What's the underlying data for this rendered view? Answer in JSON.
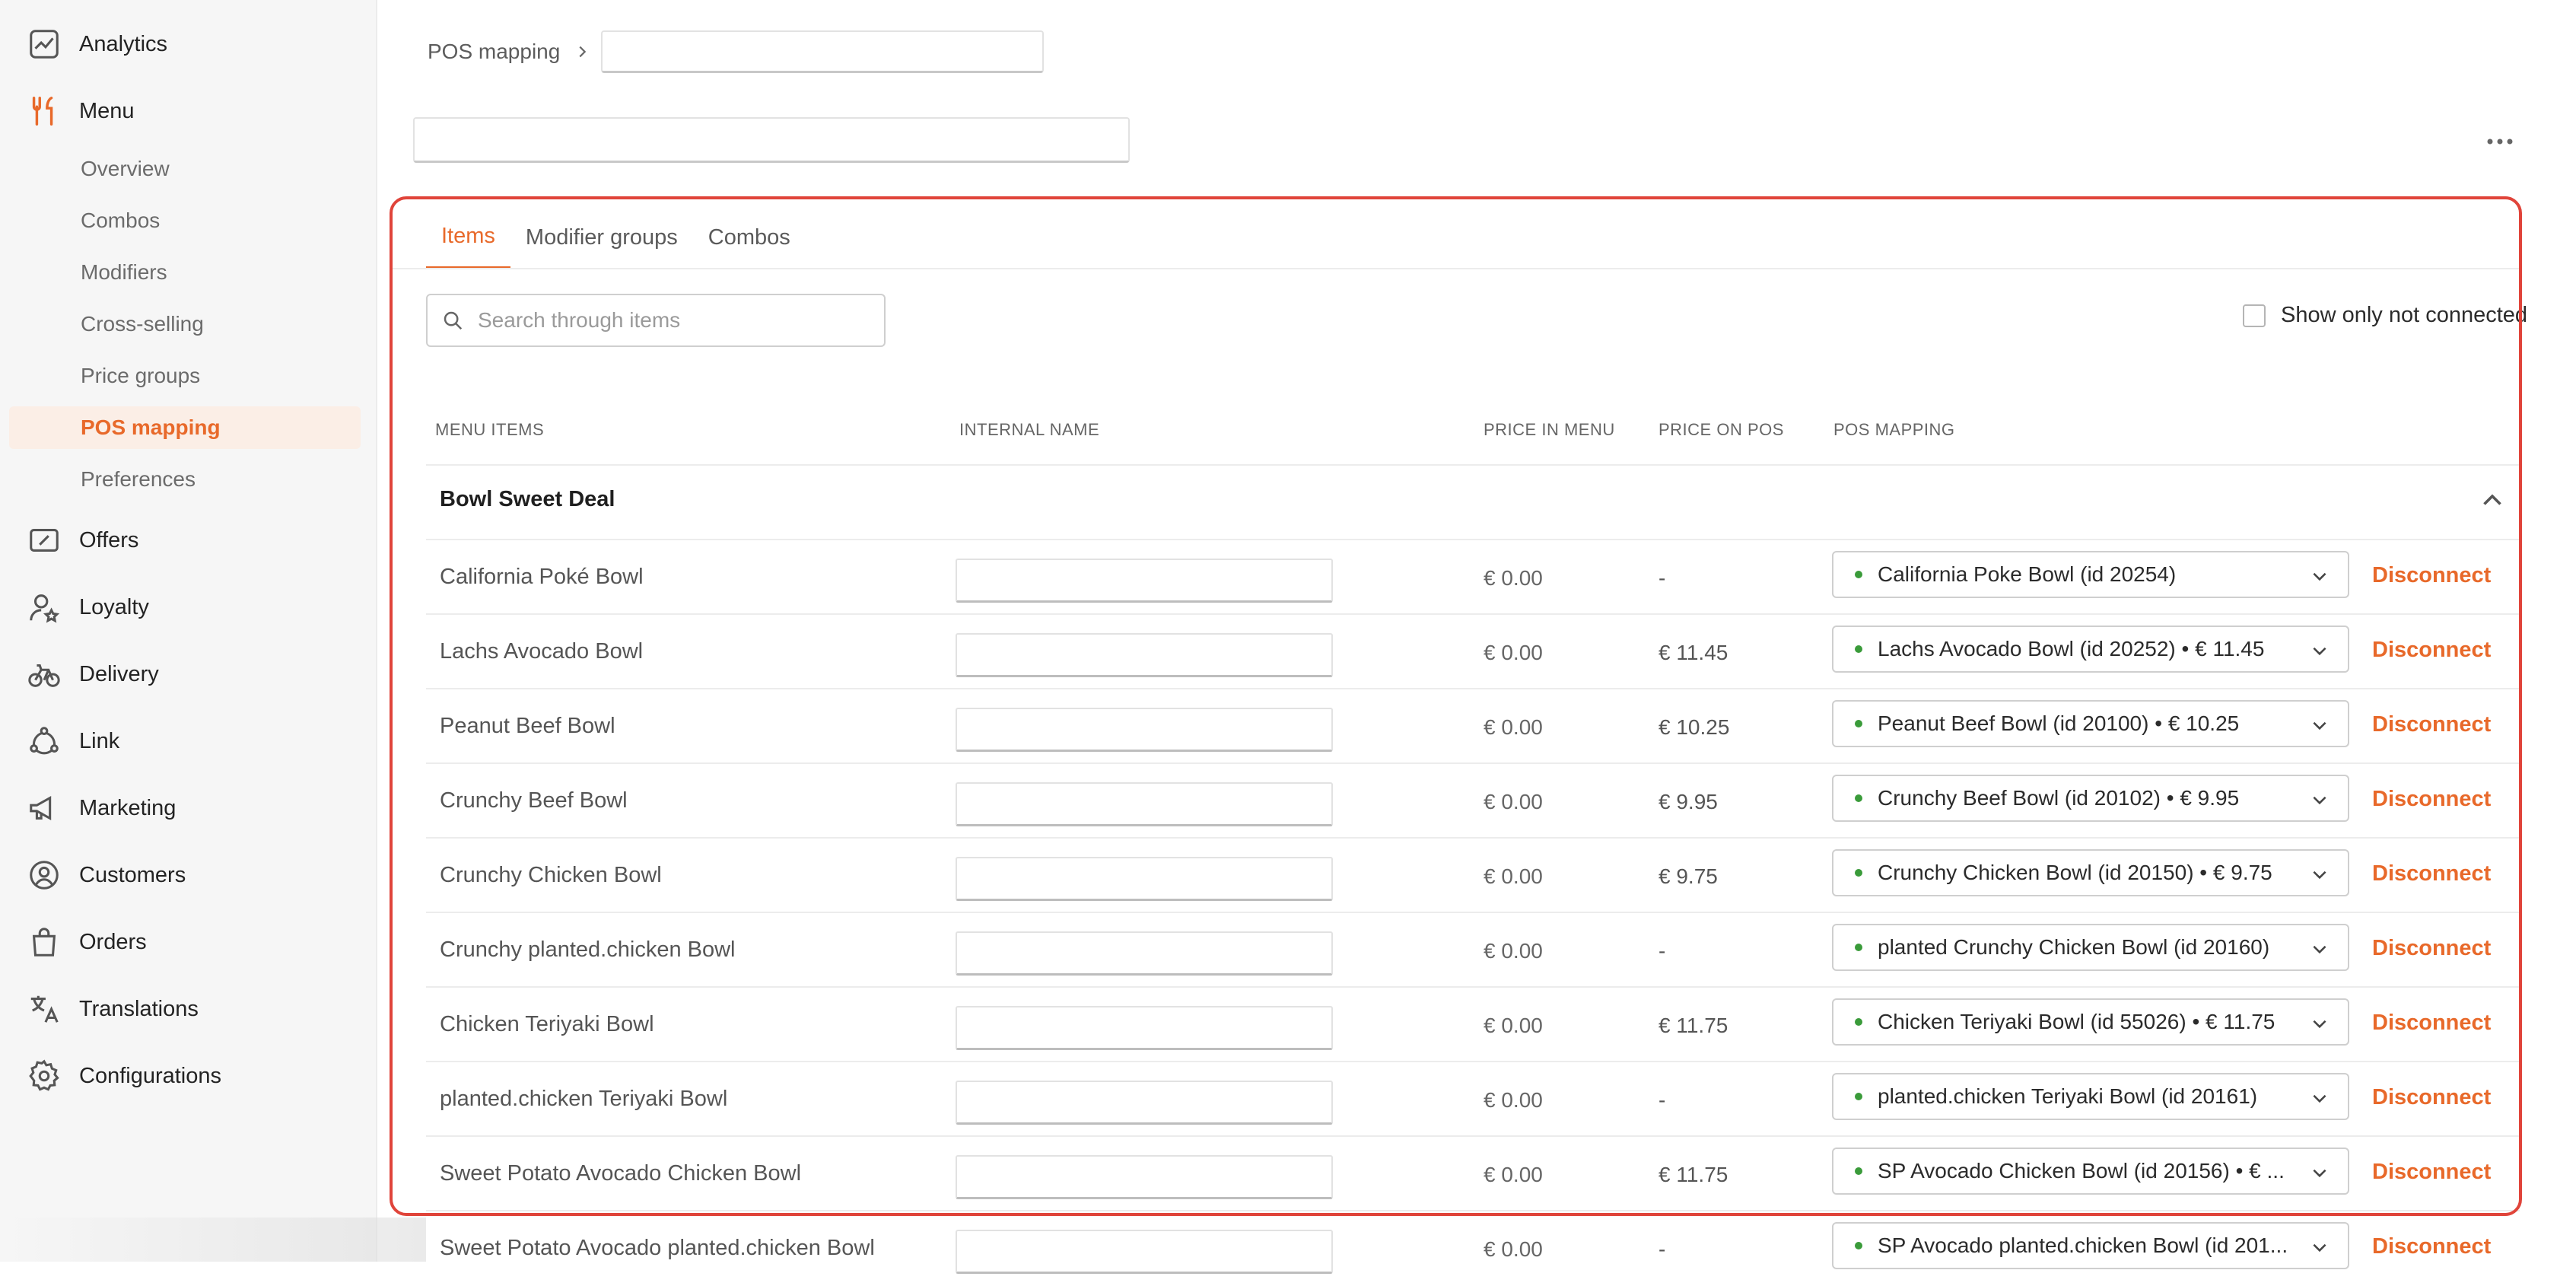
{
  "sidebar": {
    "nav": [
      {
        "label": "Analytics",
        "icon": "analytics-icon"
      },
      {
        "label": "Menu",
        "icon": "fork-knife-icon"
      },
      {
        "label": "Offers",
        "icon": "ticket-icon"
      },
      {
        "label": "Loyalty",
        "icon": "user-star-icon"
      },
      {
        "label": "Delivery",
        "icon": "bicycle-icon"
      },
      {
        "label": "Link",
        "icon": "link-icon"
      },
      {
        "label": "Marketing",
        "icon": "megaphone-icon"
      },
      {
        "label": "Customers",
        "icon": "customers-icon"
      },
      {
        "label": "Orders",
        "icon": "bag-icon"
      },
      {
        "label": "Translations",
        "icon": "translate-icon"
      },
      {
        "label": "Configurations",
        "icon": "gear-icon"
      }
    ],
    "menu_sub": [
      {
        "label": "Overview"
      },
      {
        "label": "Combos"
      },
      {
        "label": "Modifiers"
      },
      {
        "label": "Cross-selling"
      },
      {
        "label": "Price groups"
      },
      {
        "label": "POS mapping",
        "active": true
      },
      {
        "label": "Preferences"
      }
    ],
    "accent_color": "#e8692a"
  },
  "breadcrumb": {
    "root": "POS mapping"
  },
  "tabs": [
    {
      "label": "Items",
      "active": true
    },
    {
      "label": "Modifier groups"
    },
    {
      "label": "Combos"
    }
  ],
  "search": {
    "placeholder": "Search through items"
  },
  "filter": {
    "show_only_label": "Show only not connected",
    "checked": false
  },
  "table": {
    "columns": {
      "menu_items": "MENU ITEMS",
      "internal_name": "INTERNAL NAME",
      "price_in_menu": "PRICE IN MENU",
      "price_on_pos": "PRICE ON POS",
      "pos_mapping": "POS MAPPING"
    },
    "group": "Bowl Sweet Deal",
    "disconnect_label": "Disconnect",
    "rows": [
      {
        "name": "California Poké Bowl",
        "price_menu": "€ 0.00",
        "price_pos": "-",
        "mapping": "California Poke Bowl (id 20254)"
      },
      {
        "name": "Lachs Avocado Bowl",
        "price_menu": "€ 0.00",
        "price_pos": "€ 11.45",
        "mapping": "Lachs Avocado Bowl (id 20252) • € 11.45"
      },
      {
        "name": "Peanut Beef Bowl",
        "price_menu": "€ 0.00",
        "price_pos": "€ 10.25",
        "mapping": "Peanut Beef Bowl (id 20100) • € 10.25"
      },
      {
        "name": "Crunchy Beef Bowl",
        "price_menu": "€ 0.00",
        "price_pos": "€ 9.95",
        "mapping": "Crunchy Beef Bowl (id 20102) • € 9.95"
      },
      {
        "name": "Crunchy Chicken Bowl",
        "price_menu": "€ 0.00",
        "price_pos": "€ 9.75",
        "mapping": "Crunchy Chicken Bowl (id 20150) • € 9.75"
      },
      {
        "name": "Crunchy planted.chicken Bowl",
        "price_menu": "€ 0.00",
        "price_pos": "-",
        "mapping": "planted Crunchy Chicken Bowl (id 20160)"
      },
      {
        "name": "Chicken Teriyaki Bowl",
        "price_menu": "€ 0.00",
        "price_pos": "€ 11.75",
        "mapping": "Chicken Teriyaki Bowl (id 55026) • € 11.75"
      },
      {
        "name": "planted.chicken Teriyaki Bowl",
        "price_menu": "€ 0.00",
        "price_pos": "-",
        "mapping": "planted.chicken Teriyaki Bowl (id 20161)"
      },
      {
        "name": "Sweet Potato Avocado Chicken Bowl",
        "price_menu": "€ 0.00",
        "price_pos": "€ 11.75",
        "mapping": "SP Avocado Chicken Bowl (id 20156) • € ..."
      },
      {
        "name": "Sweet Potato Avocado planted.chicken Bowl",
        "price_menu": "€ 0.00",
        "price_pos": "-",
        "mapping": "SP Avocado planted.chicken Bowl (id 201..."
      }
    ]
  },
  "status_colors": {
    "connected": "#3a9b3a",
    "highlight_border": "#e0443a"
  }
}
